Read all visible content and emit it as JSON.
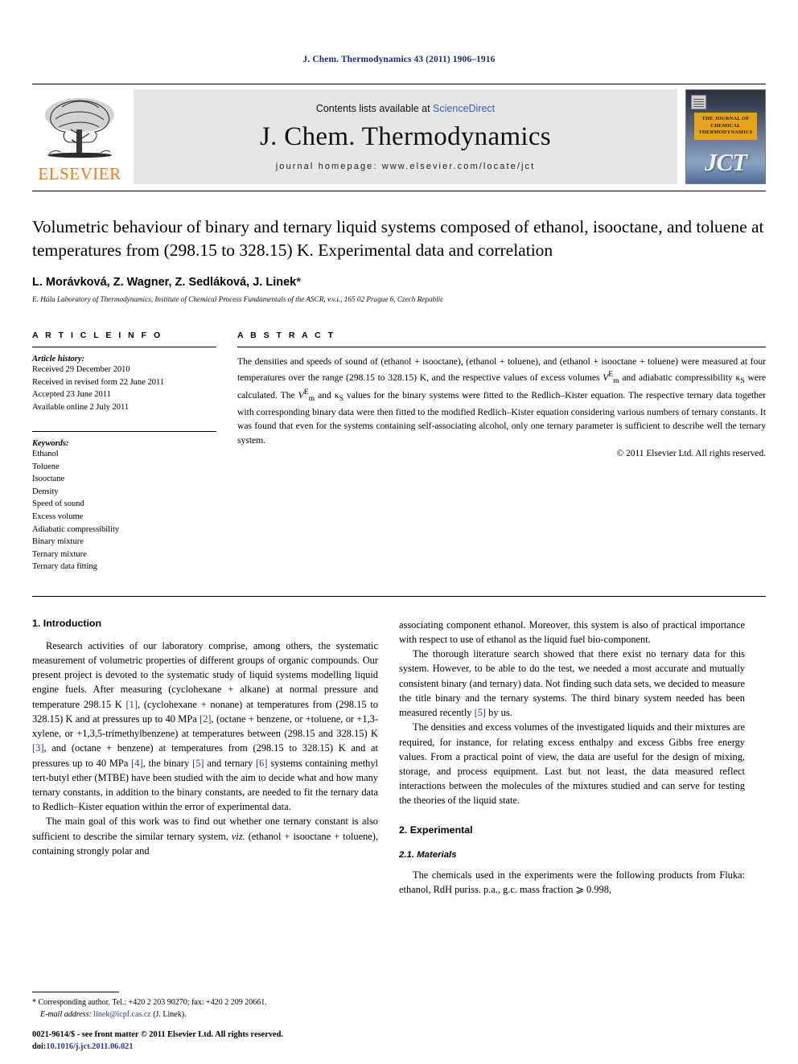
{
  "running_head": "J. Chem. Thermodynamics 43 (2011) 1906–1916",
  "masthead": {
    "publisher_word": "ELSEVIER",
    "contents_prefix": "Contents lists available at ",
    "contents_link": "ScienceDirect",
    "journal_name": "J. Chem. Thermodynamics",
    "homepage": "journal homepage: www.elsevier.com/locate/jct",
    "cover_title": "THE JOURNAL OF CHEMICAL THERMODYNAMICS",
    "cover_acronym": "JCT"
  },
  "article": {
    "title": "Volumetric behaviour of binary and ternary liquid systems composed of ethanol, isooctane, and toluene at temperatures from (298.15 to 328.15) K. Experimental data and correlation",
    "authors": "L. Morávková, Z. Wagner, Z. Sedláková, J. Linek",
    "author_star": "*",
    "affiliation": "E. Hála Laboratory of Thermodynamics, Institute of Chemical Process Fundamentals of the ASCR, v.v.i., 165 02 Prague 6, Czech Republic"
  },
  "article_info": {
    "label": "A R T I C L E  I N F O",
    "history_title": "Article history:",
    "history": [
      "Received 29 December 2010",
      "Received in revised form 22 June 2011",
      "Accepted 23 June 2011",
      "Available online 2 July 2011"
    ],
    "keywords_title": "Keywords:",
    "keywords": [
      "Ethanol",
      "Toluene",
      "Isooctane",
      "Density",
      "Speed of sound",
      "Excess volume",
      "Adiabatic compressibility",
      "Binary mixture",
      "Ternary mixture",
      "Ternary data fitting"
    ]
  },
  "abstract": {
    "label": "A B S T R A C T",
    "text_part1": "The densities and speeds of sound of (ethanol + isooctane), (ethanol + toluene), and (ethanol + isooctane + toluene) were measured at four temperatures over the range (298.15 to 328.15) K, and the respective values of excess volumes ",
    "symbol_v1": "V",
    "symbol_v1_sup": "E",
    "symbol_v1_sub": "m",
    "text_part2": " and adiabatic compressibility ",
    "symbol_k1": "κ",
    "symbol_k1_sub": "S",
    "text_part3": " were calculated. The ",
    "symbol_v2": "V",
    "symbol_v2_sup": "E",
    "symbol_v2_sub": "m",
    "text_part4": " and ",
    "symbol_k2": "κ",
    "symbol_k2_sub": "S",
    "text_part5": " values for the binary systems were fitted to the Redlich–Kister equation. The respective ternary data together with corresponding binary data were then fitted to the modified Redlich–Kister equation considering various numbers of ternary constants. It was found that even for the systems containing self-associating alcohol, only one ternary parameter is sufficient to describe well the ternary system.",
    "copyright": "© 2011 Elsevier Ltd. All rights reserved."
  },
  "sections": {
    "introduction_heading": "1. Introduction",
    "intro_p1_a": "Research activities of our laboratory comprise, among others, the systematic measurement of volumetric properties of different groups of organic compounds. Our present project is devoted to the systematic study of liquid systems modelling liquid engine fuels. After measuring (cyclohexane + alkane) at normal pressure and temperature 298.15 K ",
    "cite1": "[1]",
    "intro_p1_b": ", (cyclohexane + nonane) at temperatures from (298.15 to 328.15) K and at pressures up to 40 MPa ",
    "cite2": "[2]",
    "intro_p1_c": ", (octane + benzene, or +toluene, or +1,3-xylene, or +1,3,5-trimethylbenzene) at temperatures between (298.15 and 328.15) K ",
    "cite3": "[3]",
    "intro_p1_d": ", and (octane + benzene) at temperatures from (298.15 to 328.15) K and at pressures up to 40 MPa ",
    "cite4": "[4]",
    "intro_p1_e": ", the binary ",
    "cite5": "[5]",
    "intro_p1_f": " and ternary ",
    "cite6": "[6]",
    "intro_p1_g": " systems containing methyl tert-butyl ether (MTBE) have been studied with the aim to decide what and how many ternary constants, in addition to the binary constants, are needed to fit the ternary data to Redlich–Kister equation within the error of experimental data.",
    "intro_p2_a": "The main goal of this work was to find out whether one ternary constant is also sufficient to describe the similar ternary system, ",
    "intro_p2_viz": "viz.",
    "intro_p2_b": " (ethanol + isooctane + toluene), containing strongly polar and",
    "intro_p3": "associating component ethanol. Moreover, this system is also of practical importance with respect to use of ethanol as the liquid fuel bio-component.",
    "intro_p4_a": "The thorough literature search showed that there exist no ternary data for this system. However, to be able to do the test, we needed a most accurate and mutually consistent binary (and ternary) data. Not finding such data sets, we decided to measure the title binary and the ternary systems. The third binary system needed has been measured recently ",
    "cite5b": "[5]",
    "intro_p4_b": " by us.",
    "intro_p5": "The densities and excess volumes of the investigated liquids and their mixtures are required, for instance, for relating excess enthalpy and excess Gibbs free energy values. From a practical point of view, the data are useful for the design of mixing, storage, and process equipment. Last but not least, the data measured reflect interactions between the molecules of the mixtures studied and can serve for testing the theories of the liquid state.",
    "experimental_heading": "2. Experimental",
    "materials_heading": "2.1. Materials",
    "materials_p1": "The chemicals used in the experiments were the following products from Fluka: ethanol, RdH puriss. p.a., g.c. mass fraction ⩾ 0.998,"
  },
  "footnote": {
    "star": "*",
    "corresponding": " Corresponding author. Tel.: +420 2 203 90270; fax: +420 2 209 20661.",
    "email_label": "E-mail address:",
    "email": "linek@icpf.cas.cz",
    "email_owner": " (J. Linek)."
  },
  "footer": {
    "issn_line": "0021-9614/$ - see front matter © 2011 Elsevier Ltd. All rights reserved.",
    "doi_label": "doi:",
    "doi": "10.1016/j.jct.2011.06.021"
  },
  "colors": {
    "link_blue": "#1f3fa0",
    "running_head_blue": "#1a2f7a",
    "elsevier_orange": "#ef7d1a",
    "sciencedirect_blue": "#2f5fc7",
    "masthead_grey": "#e6e6e6"
  }
}
